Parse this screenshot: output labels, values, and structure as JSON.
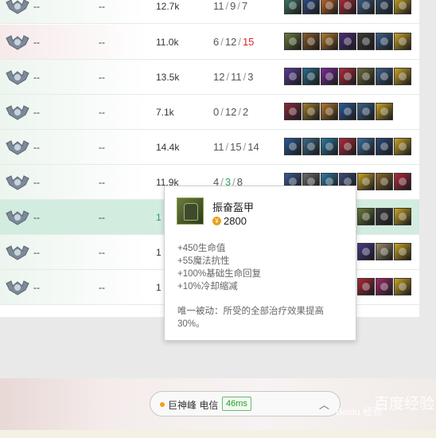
{
  "rows": [
    {
      "c1": "--",
      "c2": "--",
      "gold": "12.7k",
      "k": "11",
      "d": "9",
      "a": "7",
      "d_hot": false,
      "a_green": false,
      "items": [
        "#3d7b6a",
        "#2f4d8a",
        "#c26a2a",
        "#b12a3a",
        "#3a5f8a",
        "#2d4b6a",
        "#c8a324"
      ]
    },
    {
      "c1": "--",
      "c2": "--",
      "gold": "11.0k",
      "k": "6",
      "d": "12",
      "a": "15",
      "a_hot": true,
      "items": [
        "#6b7b3c",
        "#8a5a2a",
        "#b27a2a",
        "#4a2a7a",
        "#3a3a3a",
        "#3a5f8a",
        "#c8a324"
      ]
    },
    {
      "c1": "--",
      "c2": "--",
      "gold": "13.5k",
      "k": "12",
      "d": "11",
      "a": "3",
      "items": [
        "#5a3a9a",
        "#2a6a8a",
        "#7a2aa0",
        "#b12a3a",
        "#6a6a3a",
        "#3a5f8a",
        "#c8a324"
      ]
    },
    {
      "c1": "--",
      "c2": "--",
      "gold": "7.1k",
      "k": "0",
      "d": "12",
      "a": "2",
      "items": [
        "#8a2a3a",
        "#a07a2a",
        "#b2782a",
        "#2a5a9a",
        "#3a5f8a",
        "#c8a324"
      ]
    },
    {
      "c1": "--",
      "c2": "--",
      "gold": "14.4k",
      "k": "11",
      "d": "15",
      "a": "14",
      "items": [
        "#2a5a9a",
        "#3a6a8a",
        "#2a7aa0",
        "#b12a3a",
        "#3a6aa0",
        "#2a4a7a",
        "#c8a324"
      ]
    },
    {
      "c1": "--",
      "c2": "--",
      "gold": "11.9k",
      "k": "4",
      "d": "3",
      "a": "8",
      "d_green": true,
      "items": [
        "#3a5a9a",
        "#6a6a6a",
        "#2a7aa0",
        "#3a4a7a",
        "#c8a324",
        "#8a6a2a",
        "#b12a3a"
      ]
    },
    {
      "c1": "--",
      "c2": "--",
      "gold": "1",
      "k": "",
      "d": "",
      "a": "",
      "items": [
        "#6b7b3c",
        "#3a3a3a",
        "#c8a324"
      ]
    },
    {
      "c1": "--",
      "c2": "--",
      "gold": "1",
      "k": "",
      "d": "",
      "a": "",
      "items": [
        "#4a3a8a",
        "#9a8a6a",
        "#c8a324"
      ]
    },
    {
      "c1": "--",
      "c2": "--",
      "gold": "1",
      "k": "",
      "d": "",
      "a": "",
      "items": [
        "#b12a3a",
        "#a02a6a",
        "#c8a324"
      ]
    }
  ],
  "tooltip": {
    "title": "振奋盔甲",
    "price": "2800",
    "coin_glyph": "¥",
    "stats": [
      "+450生命值",
      "+55魔法抗性",
      "+100%基础生命回复",
      "+10%冷却缩减"
    ],
    "passive": "唯一被动：所受的全部治疗效果提高30%。"
  },
  "server": {
    "name": "巨神峰 电信",
    "ping": "46ms"
  },
  "watermark": {
    "text": "百度经验",
    "sub": "Baidu 经验"
  }
}
